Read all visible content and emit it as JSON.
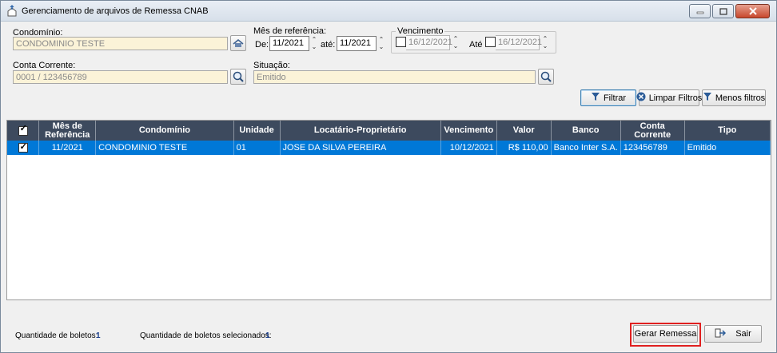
{
  "window": {
    "title": "Gerenciamento de arquivos de Remessa CNAB",
    "controls": [
      "minimize-icon",
      "maximize-icon",
      "close-icon"
    ]
  },
  "filters": {
    "condominio": {
      "label": "Condomínio:",
      "value": "CONDOMINIO TESTE"
    },
    "mes_referencia": {
      "label": "Mês de referência:",
      "de_label": "De:",
      "de_value": "11/2021",
      "ate_label": "até:",
      "ate_value": "11/2021"
    },
    "vencimento": {
      "label": "Vencimento",
      "from_value": "16/12/2021",
      "ate_label": "Até",
      "to_value": "16/12/2021"
    },
    "conta_corrente": {
      "label": "Conta Corrente:",
      "value": "0001 / 123456789"
    },
    "situacao": {
      "label": "Situação:",
      "value": "Emitido"
    },
    "buttons": {
      "filtrar": "Filtrar",
      "limpar": "Limpar Filtros",
      "menos": "Menos filtros"
    }
  },
  "grid": {
    "columns": [
      {
        "line1": "Mês de",
        "line2": "Referência"
      },
      {
        "line1": "Condomínio",
        "line2": ""
      },
      {
        "line1": "Unidade",
        "line2": ""
      },
      {
        "line1": "Locatário-Proprietário",
        "line2": ""
      },
      {
        "line1": "Vencimento",
        "line2": ""
      },
      {
        "line1": "Valor",
        "line2": ""
      },
      {
        "line1": "Banco",
        "line2": ""
      },
      {
        "line1": "Conta",
        "line2": "Corrente"
      },
      {
        "line1": "Tipo",
        "line2": ""
      }
    ],
    "rows": [
      {
        "mes": "11/2021",
        "condominio": "CONDOMINIO TESTE",
        "unidade": "01",
        "locatario": "JOSE DA SILVA PEREIRA",
        "vencimento": "10/12/2021",
        "valor": "R$ 110,00",
        "banco": "Banco Inter S.A.",
        "conta": "123456789",
        "tipo": "Emitido"
      }
    ]
  },
  "footer": {
    "qtd_boletos_label": "Quantidade de boletos:",
    "qtd_boletos_value": "1",
    "qtd_selecionados_label": "Quantidade de boletos selecionados:",
    "qtd_selecionados_value": "1",
    "gerar_label": "Gerar Remessa",
    "sair_label": "Sair"
  },
  "colors": {
    "selection": "#0078d7",
    "header": "#3d4a5e",
    "input_bg": "#fbf3d8",
    "highlight": "#e02020"
  }
}
